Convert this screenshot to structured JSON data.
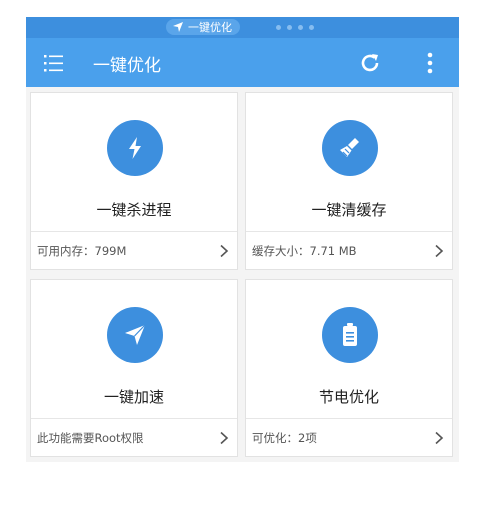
{
  "status_bar": {
    "notification_text": "一键优化"
  },
  "app_bar": {
    "title": "一键优化",
    "icons": [
      "menu-icon",
      "refresh-icon",
      "more-vertical-icon"
    ]
  },
  "cards": [
    {
      "title": "一键杀进程",
      "footer": "可用内存：799M",
      "icon": "lightning-icon"
    },
    {
      "title": "一键清缓存",
      "footer": "缓存大小：7.71 MB",
      "icon": "broom-icon"
    },
    {
      "title": "一键加速",
      "footer": "此功能需要Root权限",
      "icon": "paper-plane-icon"
    },
    {
      "title": "节电优化",
      "footer": "可优化：2项",
      "icon": "battery-icon"
    }
  ],
  "colors": {
    "status_bar": "#3d8fde",
    "app_bar": "#4aa0ec",
    "icon_circle": "#3d8fde",
    "background": "#f4f4f4"
  }
}
